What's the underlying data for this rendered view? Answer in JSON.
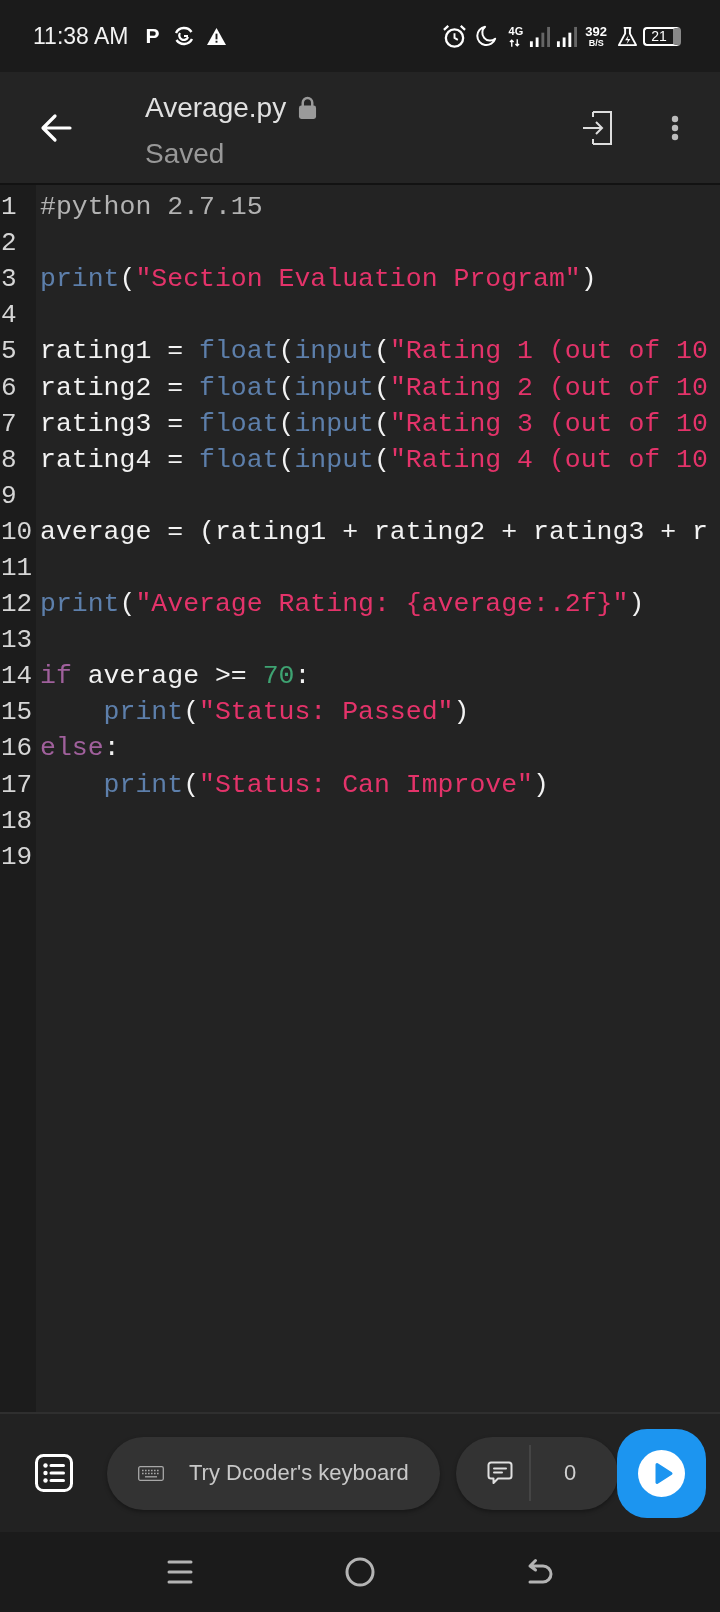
{
  "status_bar": {
    "time": "11:38 AM",
    "notification_letter": "P",
    "network_type": "4G",
    "data_speed": "392",
    "data_speed_unit": "B/S",
    "battery": "21"
  },
  "header": {
    "title": "Average.py",
    "subtitle": "Saved"
  },
  "editor": {
    "lines": [
      {
        "number": "1",
        "tokens": [
          {
            "kind": "comment",
            "text": "#python 2.7.15"
          }
        ]
      },
      {
        "number": "2"
      },
      {
        "number": "3",
        "tokens": [
          {
            "kind": "builtin",
            "text": "print"
          },
          {
            "kind": "plain",
            "text": "("
          },
          {
            "kind": "string",
            "text": "\"Section Evaluation Program\""
          },
          {
            "kind": "plain",
            "text": ")"
          }
        ]
      },
      {
        "number": "4"
      },
      {
        "number": "5",
        "tokens": [
          {
            "kind": "plain",
            "text": "rating1 = "
          },
          {
            "kind": "builtin",
            "text": "float"
          },
          {
            "kind": "plain",
            "text": "("
          },
          {
            "kind": "builtin",
            "text": "input"
          },
          {
            "kind": "plain",
            "text": "("
          },
          {
            "kind": "string",
            "text": "\"Rating 1 (out of 10"
          }
        ]
      },
      {
        "number": "6",
        "tokens": [
          {
            "kind": "plain",
            "text": "rating2 = "
          },
          {
            "kind": "builtin",
            "text": "float"
          },
          {
            "kind": "plain",
            "text": "("
          },
          {
            "kind": "builtin",
            "text": "input"
          },
          {
            "kind": "plain",
            "text": "("
          },
          {
            "kind": "string",
            "text": "\"Rating 2 (out of 10"
          }
        ]
      },
      {
        "number": "7",
        "tokens": [
          {
            "kind": "plain",
            "text": "rating3 = "
          },
          {
            "kind": "builtin",
            "text": "float"
          },
          {
            "kind": "plain",
            "text": "("
          },
          {
            "kind": "builtin",
            "text": "input"
          },
          {
            "kind": "plain",
            "text": "("
          },
          {
            "kind": "string",
            "text": "\"Rating 3 (out of 10"
          }
        ]
      },
      {
        "number": "8",
        "tokens": [
          {
            "kind": "plain",
            "text": "rating4 = "
          },
          {
            "kind": "builtin",
            "text": "float"
          },
          {
            "kind": "plain",
            "text": "("
          },
          {
            "kind": "builtin",
            "text": "input"
          },
          {
            "kind": "plain",
            "text": "("
          },
          {
            "kind": "string",
            "text": "\"Rating 4 (out of 10"
          }
        ]
      },
      {
        "number": "9"
      },
      {
        "number": "10",
        "tokens": [
          {
            "kind": "plain",
            "text": "average = (rating1 + rating2 + rating3 + r"
          }
        ]
      },
      {
        "number": "11"
      },
      {
        "number": "12",
        "tokens": [
          {
            "kind": "builtin",
            "text": "print"
          },
          {
            "kind": "plain",
            "text": "("
          },
          {
            "kind": "string",
            "text": "\"Average Rating: {average:.2f}\""
          },
          {
            "kind": "plain",
            "text": ")"
          }
        ]
      },
      {
        "number": "13"
      },
      {
        "number": "14",
        "tokens": [
          {
            "kind": "keyword",
            "text": "if"
          },
          {
            "kind": "plain",
            "text": " average >= "
          },
          {
            "kind": "number",
            "text": "70"
          },
          {
            "kind": "plain",
            "text": ":"
          }
        ],
        "children": [
          {
            "number": "15",
            "tokens": [
              {
                "kind": "builtin",
                "text": "print"
              },
              {
                "kind": "plain",
                "text": "("
              },
              {
                "kind": "string",
                "text": "\"Status: Passed\""
              },
              {
                "kind": "plain",
                "text": ")"
              }
            ]
          }
        ]
      },
      {
        "number": "16",
        "tokens": [
          {
            "kind": "keyword",
            "text": "else"
          },
          {
            "kind": "plain",
            "text": ":"
          }
        ],
        "children": [
          {
            "number": "17",
            "tokens": [
              {
                "kind": "builtin",
                "text": "print"
              },
              {
                "kind": "plain",
                "text": "("
              },
              {
                "kind": "string",
                "text": "\"Status: Can Improve\""
              },
              {
                "kind": "plain",
                "text": ")"
              }
            ]
          }
        ]
      },
      {
        "number": "18"
      },
      {
        "number": "19"
      }
    ]
  },
  "bottom_bar": {
    "keyboard_prompt": "Try Dcoder's keyboard",
    "comment_count": "0"
  }
}
